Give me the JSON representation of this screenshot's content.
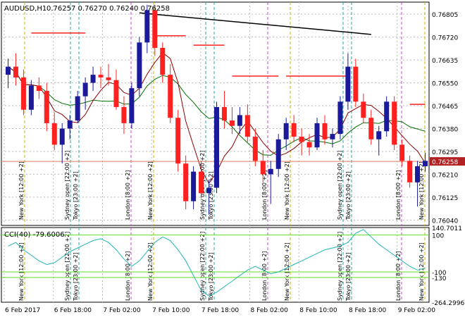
{
  "header": {
    "symbol_timeframe": "AUDUSD,H1",
    "quotes": "0.76257 0.76270 0.76240 0.76258",
    "cci_caption": "CCI(40) -79.6006"
  },
  "chart_data": [
    {
      "type": "candlestick",
      "title": "AUDUSD,H1",
      "ylim": [
        0.7602,
        0.7685
      ],
      "y_ticks": [
        "0.76805",
        "0.76720",
        "0.76635",
        "0.76550",
        "0.76465",
        "0.76380",
        "0.76295",
        "0.76210",
        "0.76125",
        "0.76040"
      ],
      "current_price": "0.76258",
      "candles": [
        [
          0.7658,
          0.7664,
          0.7653,
          0.7661
        ],
        [
          0.7661,
          0.7666,
          0.7654,
          0.7657
        ],
        [
          0.7657,
          0.766,
          0.7643,
          0.7645
        ],
        [
          0.7645,
          0.7656,
          0.7643,
          0.7654
        ],
        [
          0.7654,
          0.7657,
          0.7649,
          0.7652
        ],
        [
          0.7652,
          0.7655,
          0.7637,
          0.764
        ],
        [
          0.764,
          0.7644,
          0.763,
          0.7632
        ],
        [
          0.7632,
          0.764,
          0.7625,
          0.7638
        ],
        [
          0.7638,
          0.7643,
          0.7634,
          0.7641
        ],
        [
          0.7641,
          0.7652,
          0.764,
          0.765
        ],
        [
          0.765,
          0.7657,
          0.7645,
          0.7655
        ],
        [
          0.7655,
          0.7661,
          0.7652,
          0.7658
        ],
        [
          0.7658,
          0.7661,
          0.7653,
          0.7657
        ],
        [
          0.7657,
          0.7662,
          0.7654,
          0.7656
        ],
        [
          0.7656,
          0.766,
          0.7645,
          0.7646
        ],
        [
          0.7646,
          0.765,
          0.7636,
          0.764
        ],
        [
          0.764,
          0.7655,
          0.7638,
          0.7653
        ],
        [
          0.7653,
          0.7672,
          0.765,
          0.767
        ],
        [
          0.767,
          0.7684,
          0.7666,
          0.7682
        ],
        [
          0.7682,
          0.7684,
          0.7665,
          0.7668
        ],
        [
          0.7668,
          0.767,
          0.7655,
          0.7658
        ],
        [
          0.7658,
          0.7662,
          0.764,
          0.7642
        ],
        [
          0.7642,
          0.7645,
          0.7622,
          0.7625
        ],
        [
          0.7625,
          0.7628,
          0.7608,
          0.7611
        ],
        [
          0.7611,
          0.7624,
          0.7608,
          0.7622
        ],
        [
          0.7622,
          0.7626,
          0.7612,
          0.7614
        ],
        [
          0.7614,
          0.7619,
          0.7606,
          0.7616
        ],
        [
          0.7616,
          0.7648,
          0.7614,
          0.7646
        ],
        [
          0.7646,
          0.7652,
          0.7638,
          0.7641
        ],
        [
          0.7641,
          0.7646,
          0.7636,
          0.7639
        ],
        [
          0.7639,
          0.7646,
          0.7636,
          0.7643
        ],
        [
          0.7643,
          0.7647,
          0.7633,
          0.7635
        ],
        [
          0.7635,
          0.7638,
          0.7624,
          0.7626
        ],
        [
          0.7626,
          0.763,
          0.7618,
          0.7621
        ],
        [
          0.7621,
          0.7626,
          0.761,
          0.7623
        ],
        [
          0.7623,
          0.7636,
          0.762,
          0.7634
        ],
        [
          0.7634,
          0.7642,
          0.763,
          0.764
        ],
        [
          0.764,
          0.7643,
          0.7633,
          0.7635
        ],
        [
          0.7635,
          0.7638,
          0.7628,
          0.7633
        ],
        [
          0.7633,
          0.7636,
          0.7628,
          0.7631
        ],
        [
          0.7631,
          0.7642,
          0.763,
          0.764
        ],
        [
          0.764,
          0.7643,
          0.7632,
          0.7634
        ],
        [
          0.7634,
          0.7638,
          0.7631,
          0.7636
        ],
        [
          0.7636,
          0.765,
          0.7634,
          0.7648
        ],
        [
          0.7648,
          0.7666,
          0.7645,
          0.7661
        ],
        [
          0.7661,
          0.7664,
          0.7646,
          0.7648
        ],
        [
          0.7648,
          0.7651,
          0.764,
          0.7642
        ],
        [
          0.7642,
          0.7645,
          0.7632,
          0.7634
        ],
        [
          0.7634,
          0.7639,
          0.7628,
          0.7637
        ],
        [
          0.7637,
          0.765,
          0.7635,
          0.7648
        ],
        [
          0.7648,
          0.765,
          0.763,
          0.7632
        ],
        [
          0.7632,
          0.7634,
          0.7624,
          0.7626
        ],
        [
          0.7626,
          0.7628,
          0.7616,
          0.7618
        ],
        [
          0.7618,
          0.7626,
          0.7609,
          0.7624
        ],
        [
          0.7624,
          0.7629,
          0.7622,
          0.7626
        ]
      ]
    },
    {
      "type": "line",
      "title": "CCI(40)",
      "ylim": [
        -264.2996,
        140.7011
      ],
      "y_ticks": [
        "140.7011",
        "100",
        "-100",
        "-130",
        "-264.2996"
      ],
      "levels": [
        100,
        -100,
        -130
      ],
      "series": [
        {
          "values": [
            40,
            60,
            20,
            -10,
            -40,
            -60,
            -50,
            -20,
            10,
            30,
            50,
            70,
            80,
            60,
            20,
            -30,
            -70,
            -40,
            10,
            60,
            90,
            70,
            20,
            -40,
            -120,
            -200,
            -230,
            -210,
            -180,
            -150,
            -120,
            -90,
            -70,
            -90,
            -110,
            -100,
            -80,
            -60,
            -40,
            -20,
            0,
            20,
            30,
            40,
            60,
            110,
            130,
            90,
            50,
            20,
            -10,
            -40,
            -70,
            -90,
            -79.6
          ]
        }
      ]
    }
  ],
  "session_labels": [
    "New York [12:00 +2]",
    "Sydney open [22:00 +2]",
    "Tokyo [23:00 +2]",
    "London [8:00 +2]",
    "New York [12:00 +2]",
    "Sydney open [22:00 +2]",
    "Tokyo [23:00 +2]",
    "London [8:00 +2]",
    "New York [12:00 +2]",
    "Sydney open [22:00 +2]",
    "Tokyo [23:00 +2]",
    "London [8:00 +2]",
    "New York [12:00 +2]"
  ],
  "time_axis": [
    "6 Feb 2017",
    "6 Feb 18:00",
    "7 Feb 02:00",
    "7 Feb 10:00",
    "7 Feb 18:00",
    "8 Feb 02:00",
    "8 Feb 10:00",
    "8 Feb 18:00",
    "9 Feb 02:00"
  ],
  "colors": {
    "bull": "#1a1a9a",
    "bear": "#ff2020",
    "ma_slow": "#007000",
    "ma_fast": "#8b0000",
    "trendline": "#000000",
    "cci_line": "#22b4b4",
    "cci_level": "#66dd22",
    "price_tag_bg": "#b22222"
  }
}
